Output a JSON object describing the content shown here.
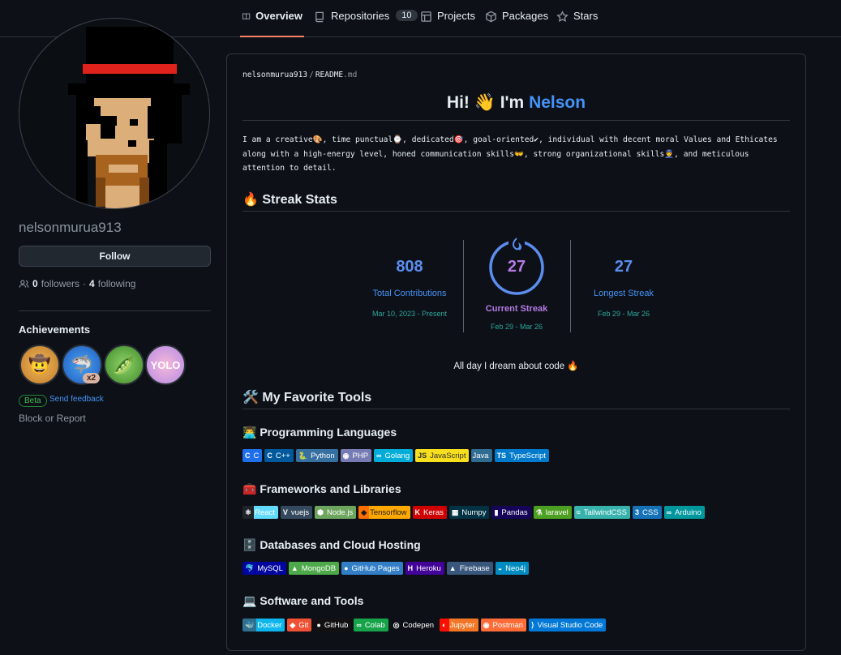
{
  "nav": {
    "tabs": [
      {
        "label": "Overview",
        "icon": "book-icon"
      },
      {
        "label": "Repositories",
        "icon": "repo-icon",
        "count": "10"
      },
      {
        "label": "Projects",
        "icon": "table-icon"
      },
      {
        "label": "Packages",
        "icon": "package-icon"
      },
      {
        "label": "Stars",
        "icon": "star-icon"
      }
    ]
  },
  "profile": {
    "username": "nelsonmurua913",
    "follow_label": "Follow",
    "followers_count": "0",
    "followers_label": "followers",
    "separator": "·",
    "following_count": "4",
    "following_label": "following"
  },
  "achievements": {
    "title": "Achievements",
    "badges": [
      {
        "icon": "cowboy-icon"
      },
      {
        "icon": "shark-icon",
        "multiplier": "x2"
      },
      {
        "icon": "pair-icon"
      },
      {
        "icon": "yolo-icon"
      }
    ],
    "beta_label": "Beta",
    "feedback_label": "Send feedback"
  },
  "block_label": "Block or Report",
  "readme": {
    "path_user": "nelsonmurua913",
    "path_sep": "/",
    "path_file": "README",
    "path_ext": ".md",
    "greeting_prefix": "Hi! 👋 I'm",
    "greeting_name": "Nelson",
    "bio": "I am a creative🎨, time punctual⌚, dedicated🎯, goal-oriented✔, individual with decent moral Values and Ethicates along with a high-energy level, honed communication skills👐, strong organizational skills👮, and meticulous attention to detail.",
    "streak_heading": "🔥 Streak Stats",
    "stats": {
      "total": {
        "value": "808",
        "label": "Total Contributions",
        "range": "Mar 10, 2023 - Present"
      },
      "current": {
        "value": "27",
        "label": "Current Streak",
        "range": "Feb 29 - Mar 26"
      },
      "longest": {
        "value": "27",
        "label": "Longest Streak",
        "range": "Feb 29 - Mar 26"
      }
    },
    "dream": "All day I dream about code 🔥",
    "tools_heading": "🛠️ My Favorite Tools",
    "sections": [
      {
        "title": "👨‍💻 Programming Languages",
        "badges": [
          {
            "icon": "C",
            "text": "C",
            "bg": "#1f6feb"
          },
          {
            "icon": "C",
            "text": "C++",
            "bg": "#00599c"
          },
          {
            "icon": "🐍",
            "text": "Python",
            "bg": "#3670a0"
          },
          {
            "icon": "◉",
            "text": "PHP",
            "bg": "#777bb4"
          },
          {
            "icon": "∞",
            "text": "Golang",
            "bg": "#00add8"
          },
          {
            "icon": "JS",
            "text": "JavaScript",
            "bg": "#f7df1e",
            "fg": "#323330"
          },
          {
            "icon": "",
            "text": "Java",
            "bg": "#2f6c91"
          },
          {
            "icon": "TS",
            "text": "TypeScript",
            "bg": "#007acc"
          }
        ]
      },
      {
        "title": "🧰 Frameworks and Libraries",
        "badges": [
          {
            "icon": "⚛",
            "text": "React",
            "bg": "#20232a",
            "textbg": "#61dafb"
          },
          {
            "icon": "V",
            "text": "vuejs",
            "bg": "#35495e"
          },
          {
            "icon": "⬢",
            "text": "Node.js",
            "bg": "#6da55f"
          },
          {
            "icon": "◆",
            "text": "Tensorflow",
            "bg": "#ff6f00",
            "fg": "#1b1b1b",
            "textbg": "#ffa800"
          },
          {
            "icon": "K",
            "text": "Keras",
            "bg": "#d00000"
          },
          {
            "icon": "▦",
            "text": "Numpy",
            "bg": "#013243"
          },
          {
            "icon": "▮",
            "text": "Pandas",
            "bg": "#150458"
          },
          {
            "icon": "⚗",
            "text": "laravel",
            "bg": "#4c9f20"
          },
          {
            "icon": "≈",
            "text": "TailwindCSS",
            "bg": "#38b2ac"
          },
          {
            "icon": "3",
            "text": "CSS",
            "bg": "#1572b6"
          },
          {
            "icon": "∞",
            "text": "Arduino",
            "bg": "#00979d"
          }
        ]
      },
      {
        "title": "🗄️ Databases and Cloud Hosting",
        "badges": [
          {
            "icon": "🐬",
            "text": "MySQL",
            "bg": "#00059f"
          },
          {
            "icon": "▲",
            "text": "MongoDB",
            "bg": "#4ea94b"
          },
          {
            "icon": "●",
            "text": "GitHub Pages",
            "bg": "#327fc7"
          },
          {
            "icon": "H",
            "text": "Heroku",
            "bg": "#430098"
          },
          {
            "icon": "▲",
            "text": "Firebase",
            "bg": "#39577c"
          },
          {
            "icon": "◒",
            "text": "Neo4j",
            "bg": "#008cc1"
          }
        ]
      },
      {
        "title": "💻 Software and Tools",
        "badges": [
          {
            "icon": "🐳",
            "text": "Docker",
            "bg": "#2f6f8f",
            "textbg": "#0db7ed"
          },
          {
            "icon": "◆",
            "text": "Git",
            "bg": "#f05033"
          },
          {
            "icon": "●",
            "text": "GitHub",
            "bg": "#121011"
          },
          {
            "icon": "∞",
            "text": "Colab",
            "bg": "#16a34a"
          },
          {
            "icon": "◎",
            "text": "Codepen",
            "bg": "#0d1117"
          },
          {
            "icon": "◐",
            "text": "Jupyter",
            "bg": "#fa0f00",
            "textbg": "#f37626"
          },
          {
            "icon": "◉",
            "text": "Postman",
            "bg": "#ff6c37"
          },
          {
            "icon": "⟩",
            "text": "Visual Studio Code",
            "bg": "#0078d7"
          }
        ]
      }
    ]
  },
  "colors": {
    "background": "#0d1117",
    "accent_blue": "#4493f8",
    "streak_ring": "#5b8def",
    "streak_current": "#b57ae6",
    "tab_underline": "#f78166"
  }
}
